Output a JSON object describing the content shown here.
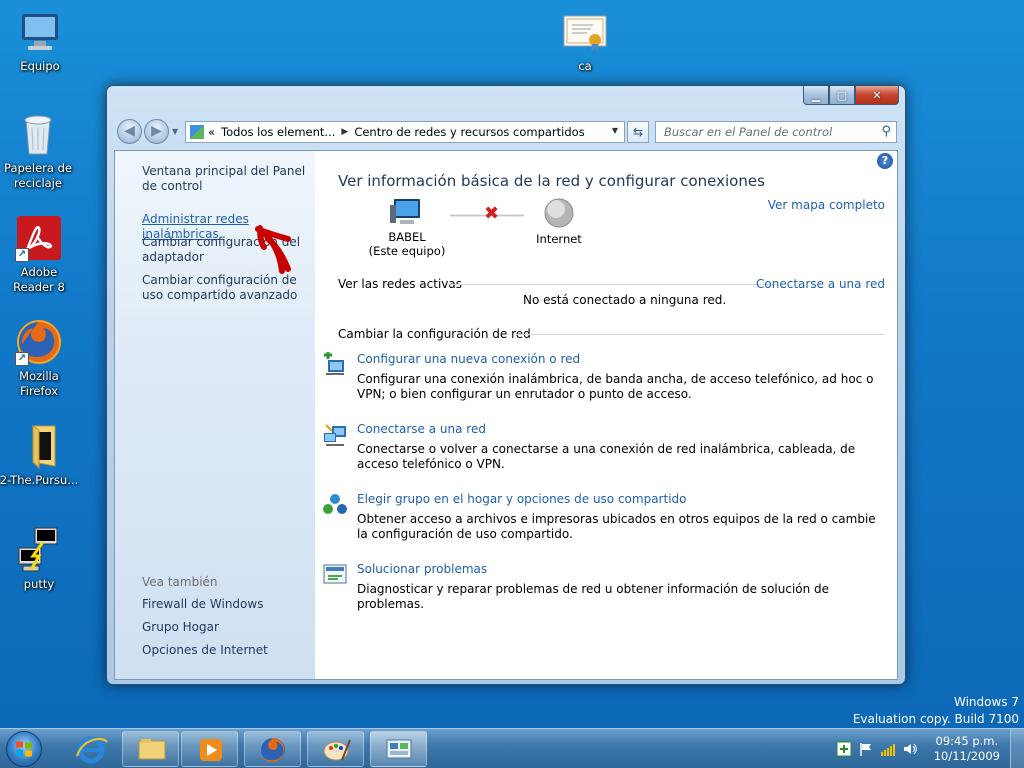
{
  "desktop": {
    "icons": [
      {
        "label": "Equipo"
      },
      {
        "label": "Papelera de reciclaje"
      },
      {
        "label": "Adobe Reader 8"
      },
      {
        "label": "Mozilla Firefox"
      },
      {
        "label": "2-The.Pursu..."
      },
      {
        "label": "putty"
      },
      {
        "label": "ca"
      }
    ],
    "watermark": {
      "line1": "Windows 7",
      "line2": "Evaluation copy. Build 7100"
    }
  },
  "window": {
    "address": {
      "root_chevron": "«",
      "segment1": "Todos los element...",
      "segment2": "Centro de redes y recursos compartidos"
    },
    "search_placeholder": "Buscar en el Panel de control",
    "left_pane": {
      "links": [
        "Ventana principal del Panel de control",
        "Administrar redes inalámbricas",
        "Cambiar configuración del adaptador",
        "Cambiar configuración de uso compartido avanzado"
      ],
      "see_also_title": "Vea también",
      "see_also": [
        "Firewall de Windows",
        "Grupo Hogar",
        "Opciones de Internet"
      ]
    },
    "main": {
      "title": "Ver información básica de la red y configurar conexiones",
      "map_link": "Ver mapa completo",
      "computer_label": "BABEL",
      "computer_sub": "(Este equipo)",
      "internet_label": "Internet",
      "active_section": "Ver las redes activas",
      "connect_link": "Conectarse a una red",
      "no_connection": "No está conectado a ninguna red.",
      "change_section": "Cambiar la configuración de red",
      "tasks": [
        {
          "title": "Configurar una nueva conexión o red",
          "desc": "Configurar una conexión inalámbrica, de banda ancha, de acceso telefónico, ad hoc o VPN; o bien configurar un enrutador o punto de acceso."
        },
        {
          "title": "Conectarse a una red",
          "desc": "Conectarse o volver a conectarse a una conexión de red inalámbrica, cableada, de acceso telefónico o VPN."
        },
        {
          "title": "Elegir grupo en el hogar y opciones de uso compartido",
          "desc": "Obtener acceso a archivos e impresoras ubicados en otros equipos de la red o cambie la configuración de uso compartido."
        },
        {
          "title": "Solucionar problemas",
          "desc": "Diagnosticar y reparar problemas de red u obtener información de solución de problemas."
        }
      ]
    }
  },
  "taskbar": {
    "time": "09:45 p.m.",
    "date": "10/11/2009"
  }
}
